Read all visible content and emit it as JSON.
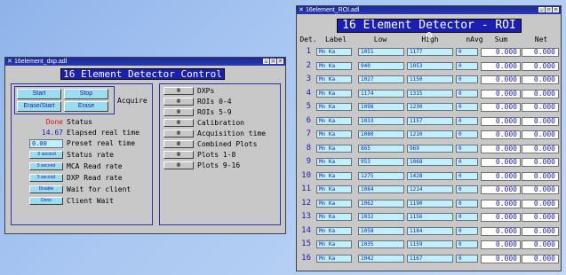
{
  "control_window": {
    "title": "16element_dxp.adl",
    "banner": "16 Element Detector Control",
    "acquire_label": "Acquire",
    "buttons": {
      "start": "Start",
      "stop": "Stop",
      "erase_start": "Erase/Start",
      "erase": "Erase"
    },
    "status_value": "Done",
    "status_label": "Status",
    "elapsed_value": "14.67",
    "elapsed_label": "Elapsed real time",
    "preset_value": "0.00",
    "preset_label": "Preset real time",
    "status_rate_value": ".5 second",
    "status_rate_label": "Status rate",
    "mca_rate_value": "5 second",
    "mca_rate_label": "MCA Read rate",
    "dxp_rate_value": "5 second",
    "dxp_rate_label": "DXP Read rate",
    "wait_value": "Disable",
    "wait_label": "Wait for client",
    "client_wait_value": "Done",
    "client_wait_label": "Client Wait",
    "related_button_glyph": "ꙮ",
    "related": [
      "DXPs",
      "ROIs 0-4",
      "ROIs 5-9",
      "Calibration",
      "Acquisition time",
      "Combined Plots",
      "Plots 1-8",
      "Plots 9-16"
    ]
  },
  "roi_window": {
    "title": "16element_ROI.adl",
    "banner": "16 Element Detector - ROI 0",
    "headers": [
      "Det.",
      "Label",
      "Low",
      "High",
      "nAvg",
      "Sum",
      "Net"
    ],
    "rows": [
      {
        "det": "1",
        "label": "Mn Ka",
        "low": "1051",
        "high": "1177",
        "navg": "0",
        "sum": "0.000",
        "net": "0.000"
      },
      {
        "det": "2",
        "label": "Mn Ka",
        "low": "940",
        "high": "1053",
        "navg": "0",
        "sum": "0.000",
        "net": "0.000"
      },
      {
        "det": "3",
        "label": "Mn Ka",
        "low": "1027",
        "high": "1150",
        "navg": "0",
        "sum": "0.000",
        "net": "0.000"
      },
      {
        "det": "4",
        "label": "Mn Ka",
        "low": "1174",
        "high": "1315",
        "navg": "0",
        "sum": "0.000",
        "net": "0.000"
      },
      {
        "det": "5",
        "label": "Mn Ka",
        "low": "1098",
        "high": "1230",
        "navg": "0",
        "sum": "0.000",
        "net": "0.000"
      },
      {
        "det": "6",
        "label": "Mn Ka",
        "low": "1033",
        "high": "1157",
        "navg": "0",
        "sum": "0.000",
        "net": "0.000"
      },
      {
        "det": "7",
        "label": "Mn Ka",
        "low": "1080",
        "high": "1210",
        "navg": "0",
        "sum": "0.000",
        "net": "0.000"
      },
      {
        "det": "8",
        "label": "Mn Ka",
        "low": "865",
        "high": "969",
        "navg": "0",
        "sum": "0.000",
        "net": "0.000"
      },
      {
        "det": "9",
        "label": "Mn Ka",
        "low": "953",
        "high": "1068",
        "navg": "0",
        "sum": "0.000",
        "net": "0.000"
      },
      {
        "det": "10",
        "label": "Mn Ka",
        "low": "1275",
        "high": "1428",
        "navg": "0",
        "sum": "0.000",
        "net": "0.000"
      },
      {
        "det": "11",
        "label": "Mn Ka",
        "low": "1084",
        "high": "1214",
        "navg": "0",
        "sum": "0.000",
        "net": "0.000"
      },
      {
        "det": "12",
        "label": "Mn Ka",
        "low": "1062",
        "high": "1190",
        "navg": "0",
        "sum": "0.000",
        "net": "0.000"
      },
      {
        "det": "13",
        "label": "Mn Ka",
        "low": "1032",
        "high": "1156",
        "navg": "0",
        "sum": "0.000",
        "net": "0.000"
      },
      {
        "det": "14",
        "label": "Mn Ka",
        "low": "1058",
        "high": "1184",
        "navg": "0",
        "sum": "0.000",
        "net": "0.000"
      },
      {
        "det": "15",
        "label": "Mn Ka",
        "low": "1035",
        "high": "1159",
        "navg": "0",
        "sum": "0.000",
        "net": "0.000"
      },
      {
        "det": "16",
        "label": "Mn Ka",
        "low": "1042",
        "high": "1167",
        "navg": "0",
        "sum": "0.000",
        "net": "0.000"
      }
    ]
  },
  "colors": {
    "banner": "#1a1fb0",
    "field": "#bff0ff",
    "button": "#9adcf0",
    "status_done": "#e01010",
    "desktop": "#a9c7f2"
  }
}
